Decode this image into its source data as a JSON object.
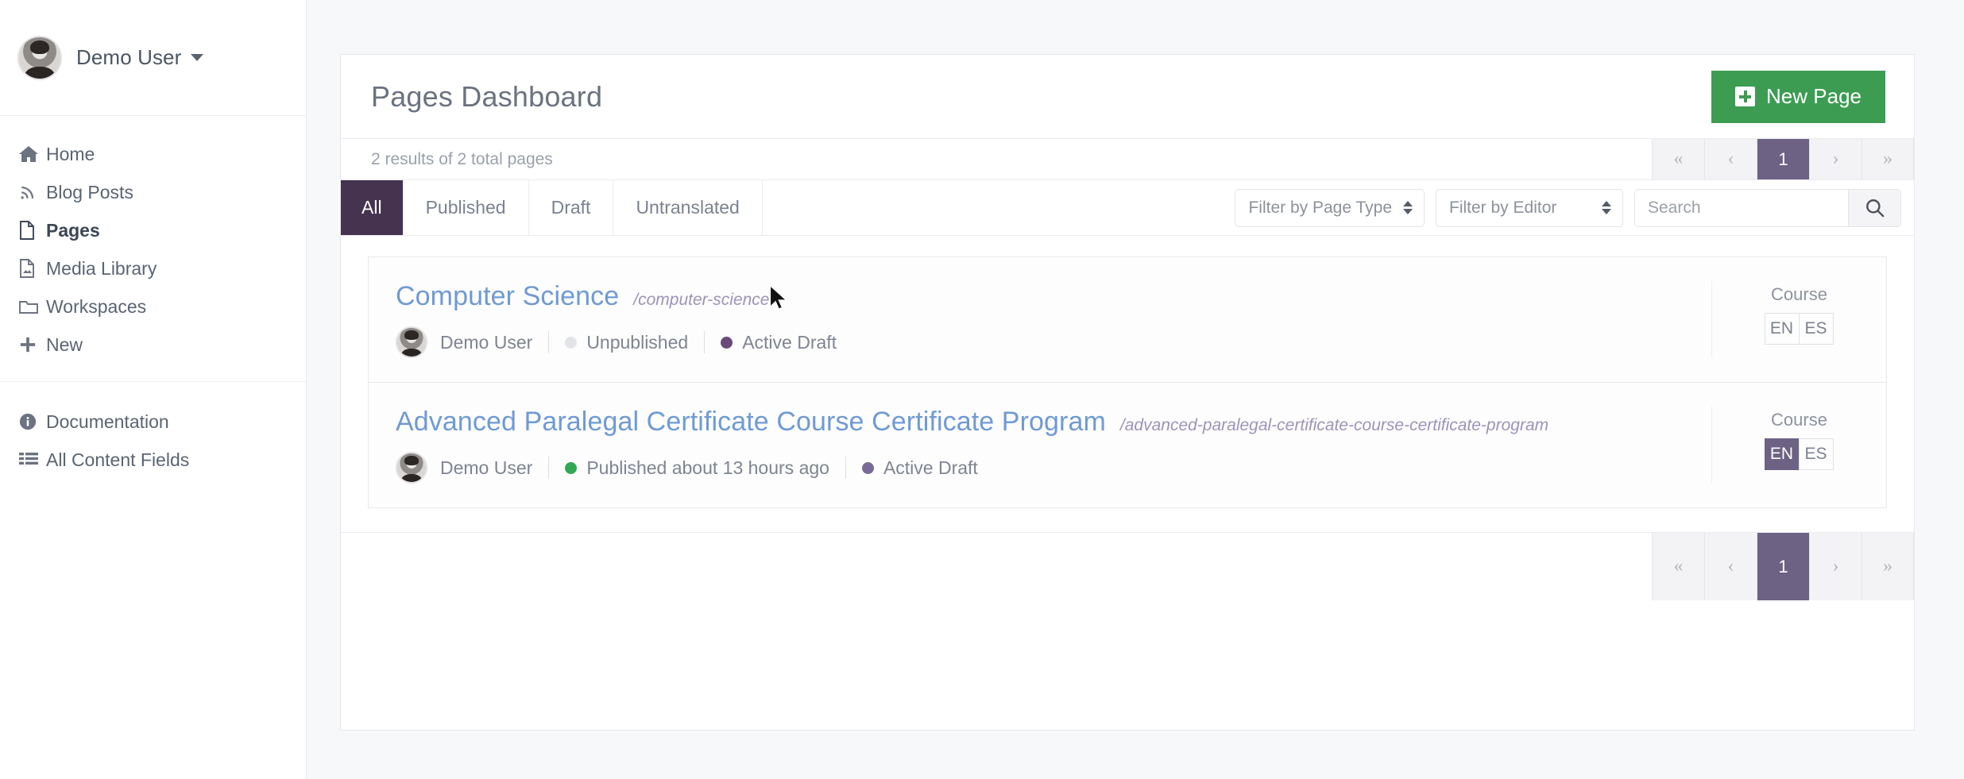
{
  "sidebar": {
    "user": {
      "name": "Demo User",
      "avatar_icon": "user-avatar",
      "caret_icon": "chevron-down-icon"
    },
    "groups": [
      {
        "items": [
          {
            "label": "Home",
            "icon": "home-icon",
            "active": false
          },
          {
            "label": "Blog Posts",
            "icon": "rss-icon",
            "active": false
          },
          {
            "label": "Pages",
            "icon": "file-icon",
            "active": true
          },
          {
            "label": "Media Library",
            "icon": "image-file-icon",
            "active": false
          },
          {
            "label": "Workspaces",
            "icon": "folder-icon",
            "active": false
          },
          {
            "label": "New",
            "icon": "plus-icon",
            "active": false
          }
        ]
      },
      {
        "items": [
          {
            "label": "Documentation",
            "icon": "info-circle-icon",
            "active": false
          },
          {
            "label": "All Content Fields",
            "icon": "list-icon",
            "active": false
          }
        ]
      }
    ]
  },
  "main": {
    "title": "Pages Dashboard",
    "new_page_button": {
      "label": "New Page",
      "icon": "plus-square-icon",
      "color": "#3c9c52"
    },
    "results_text": "2 results of 2 total pages",
    "pagination": {
      "first_label": "«",
      "prev_label": "‹",
      "current_label": "1",
      "next_label": "›",
      "last_label": "»",
      "active_color": "#6d6283"
    },
    "tabs": [
      {
        "label": "All",
        "active": true
      },
      {
        "label": "Published",
        "active": false
      },
      {
        "label": "Draft",
        "active": false
      },
      {
        "label": "Untranslated",
        "active": false
      }
    ],
    "tab_active_color": "#46334f",
    "filters": {
      "page_type": {
        "label": "Filter by Page Type",
        "icon": "sort-updown-icon"
      },
      "editor": {
        "label": "Filter by Editor",
        "icon": "sort-updown-icon"
      },
      "search": {
        "value": "",
        "placeholder": "Search",
        "icon": "search-icon"
      }
    },
    "rows": [
      {
        "title": "Computer Science",
        "slug": "/computer-science",
        "author": "Demo User",
        "status": {
          "label": "Unpublished",
          "dot_color": "#e3e4e7"
        },
        "draft": {
          "label": "Active Draft",
          "dot_color": "#6b4a7a"
        },
        "type": "Course",
        "languages": [
          {
            "code": "EN",
            "active": false
          },
          {
            "code": "ES",
            "active": false
          }
        ]
      },
      {
        "title": "Advanced Paralegal Certificate Course Certificate Program",
        "slug": "/advanced-paralegal-certificate-course-certificate-program",
        "author": "Demo User",
        "status": {
          "label": "Published about 13 hours ago",
          "dot_color": "#32a852"
        },
        "draft": {
          "label": "Active Draft",
          "dot_color": "#7a6a99"
        },
        "type": "Course",
        "languages": [
          {
            "code": "EN",
            "active": true
          },
          {
            "code": "ES",
            "active": false
          }
        ]
      }
    ]
  }
}
